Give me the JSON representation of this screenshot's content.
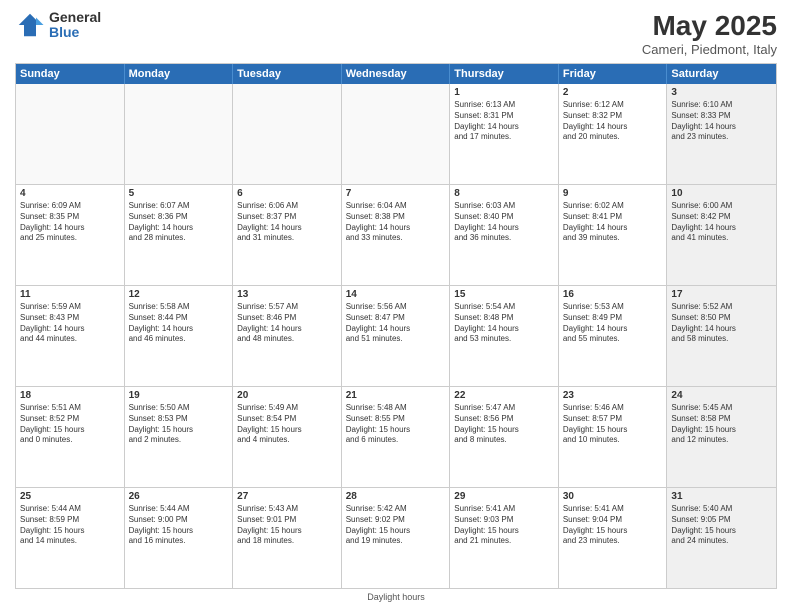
{
  "header": {
    "logo_general": "General",
    "logo_blue": "Blue",
    "title": "May 2025",
    "subtitle": "Cameri, Piedmont, Italy"
  },
  "calendar": {
    "days": [
      "Sunday",
      "Monday",
      "Tuesday",
      "Wednesday",
      "Thursday",
      "Friday",
      "Saturday"
    ],
    "rows": [
      [
        {
          "num": "",
          "text": "",
          "empty": true
        },
        {
          "num": "",
          "text": "",
          "empty": true
        },
        {
          "num": "",
          "text": "",
          "empty": true
        },
        {
          "num": "",
          "text": "",
          "empty": true
        },
        {
          "num": "1",
          "text": "Sunrise: 6:13 AM\nSunset: 8:31 PM\nDaylight: 14 hours\nand 17 minutes.",
          "empty": false,
          "shaded": false
        },
        {
          "num": "2",
          "text": "Sunrise: 6:12 AM\nSunset: 8:32 PM\nDaylight: 14 hours\nand 20 minutes.",
          "empty": false,
          "shaded": false
        },
        {
          "num": "3",
          "text": "Sunrise: 6:10 AM\nSunset: 8:33 PM\nDaylight: 14 hours\nand 23 minutes.",
          "empty": false,
          "shaded": true
        }
      ],
      [
        {
          "num": "4",
          "text": "Sunrise: 6:09 AM\nSunset: 8:35 PM\nDaylight: 14 hours\nand 25 minutes.",
          "empty": false,
          "shaded": false
        },
        {
          "num": "5",
          "text": "Sunrise: 6:07 AM\nSunset: 8:36 PM\nDaylight: 14 hours\nand 28 minutes.",
          "empty": false,
          "shaded": false
        },
        {
          "num": "6",
          "text": "Sunrise: 6:06 AM\nSunset: 8:37 PM\nDaylight: 14 hours\nand 31 minutes.",
          "empty": false,
          "shaded": false
        },
        {
          "num": "7",
          "text": "Sunrise: 6:04 AM\nSunset: 8:38 PM\nDaylight: 14 hours\nand 33 minutes.",
          "empty": false,
          "shaded": false
        },
        {
          "num": "8",
          "text": "Sunrise: 6:03 AM\nSunset: 8:40 PM\nDaylight: 14 hours\nand 36 minutes.",
          "empty": false,
          "shaded": false
        },
        {
          "num": "9",
          "text": "Sunrise: 6:02 AM\nSunset: 8:41 PM\nDaylight: 14 hours\nand 39 minutes.",
          "empty": false,
          "shaded": false
        },
        {
          "num": "10",
          "text": "Sunrise: 6:00 AM\nSunset: 8:42 PM\nDaylight: 14 hours\nand 41 minutes.",
          "empty": false,
          "shaded": true
        }
      ],
      [
        {
          "num": "11",
          "text": "Sunrise: 5:59 AM\nSunset: 8:43 PM\nDaylight: 14 hours\nand 44 minutes.",
          "empty": false,
          "shaded": false
        },
        {
          "num": "12",
          "text": "Sunrise: 5:58 AM\nSunset: 8:44 PM\nDaylight: 14 hours\nand 46 minutes.",
          "empty": false,
          "shaded": false
        },
        {
          "num": "13",
          "text": "Sunrise: 5:57 AM\nSunset: 8:46 PM\nDaylight: 14 hours\nand 48 minutes.",
          "empty": false,
          "shaded": false
        },
        {
          "num": "14",
          "text": "Sunrise: 5:56 AM\nSunset: 8:47 PM\nDaylight: 14 hours\nand 51 minutes.",
          "empty": false,
          "shaded": false
        },
        {
          "num": "15",
          "text": "Sunrise: 5:54 AM\nSunset: 8:48 PM\nDaylight: 14 hours\nand 53 minutes.",
          "empty": false,
          "shaded": false
        },
        {
          "num": "16",
          "text": "Sunrise: 5:53 AM\nSunset: 8:49 PM\nDaylight: 14 hours\nand 55 minutes.",
          "empty": false,
          "shaded": false
        },
        {
          "num": "17",
          "text": "Sunrise: 5:52 AM\nSunset: 8:50 PM\nDaylight: 14 hours\nand 58 minutes.",
          "empty": false,
          "shaded": true
        }
      ],
      [
        {
          "num": "18",
          "text": "Sunrise: 5:51 AM\nSunset: 8:52 PM\nDaylight: 15 hours\nand 0 minutes.",
          "empty": false,
          "shaded": false
        },
        {
          "num": "19",
          "text": "Sunrise: 5:50 AM\nSunset: 8:53 PM\nDaylight: 15 hours\nand 2 minutes.",
          "empty": false,
          "shaded": false
        },
        {
          "num": "20",
          "text": "Sunrise: 5:49 AM\nSunset: 8:54 PM\nDaylight: 15 hours\nand 4 minutes.",
          "empty": false,
          "shaded": false
        },
        {
          "num": "21",
          "text": "Sunrise: 5:48 AM\nSunset: 8:55 PM\nDaylight: 15 hours\nand 6 minutes.",
          "empty": false,
          "shaded": false
        },
        {
          "num": "22",
          "text": "Sunrise: 5:47 AM\nSunset: 8:56 PM\nDaylight: 15 hours\nand 8 minutes.",
          "empty": false,
          "shaded": false
        },
        {
          "num": "23",
          "text": "Sunrise: 5:46 AM\nSunset: 8:57 PM\nDaylight: 15 hours\nand 10 minutes.",
          "empty": false,
          "shaded": false
        },
        {
          "num": "24",
          "text": "Sunrise: 5:45 AM\nSunset: 8:58 PM\nDaylight: 15 hours\nand 12 minutes.",
          "empty": false,
          "shaded": true
        }
      ],
      [
        {
          "num": "25",
          "text": "Sunrise: 5:44 AM\nSunset: 8:59 PM\nDaylight: 15 hours\nand 14 minutes.",
          "empty": false,
          "shaded": false
        },
        {
          "num": "26",
          "text": "Sunrise: 5:44 AM\nSunset: 9:00 PM\nDaylight: 15 hours\nand 16 minutes.",
          "empty": false,
          "shaded": false
        },
        {
          "num": "27",
          "text": "Sunrise: 5:43 AM\nSunset: 9:01 PM\nDaylight: 15 hours\nand 18 minutes.",
          "empty": false,
          "shaded": false
        },
        {
          "num": "28",
          "text": "Sunrise: 5:42 AM\nSunset: 9:02 PM\nDaylight: 15 hours\nand 19 minutes.",
          "empty": false,
          "shaded": false
        },
        {
          "num": "29",
          "text": "Sunrise: 5:41 AM\nSunset: 9:03 PM\nDaylight: 15 hours\nand 21 minutes.",
          "empty": false,
          "shaded": false
        },
        {
          "num": "30",
          "text": "Sunrise: 5:41 AM\nSunset: 9:04 PM\nDaylight: 15 hours\nand 23 minutes.",
          "empty": false,
          "shaded": false
        },
        {
          "num": "31",
          "text": "Sunrise: 5:40 AM\nSunset: 9:05 PM\nDaylight: 15 hours\nand 24 minutes.",
          "empty": false,
          "shaded": true
        }
      ]
    ]
  },
  "footer": {
    "text": "Daylight hours"
  }
}
